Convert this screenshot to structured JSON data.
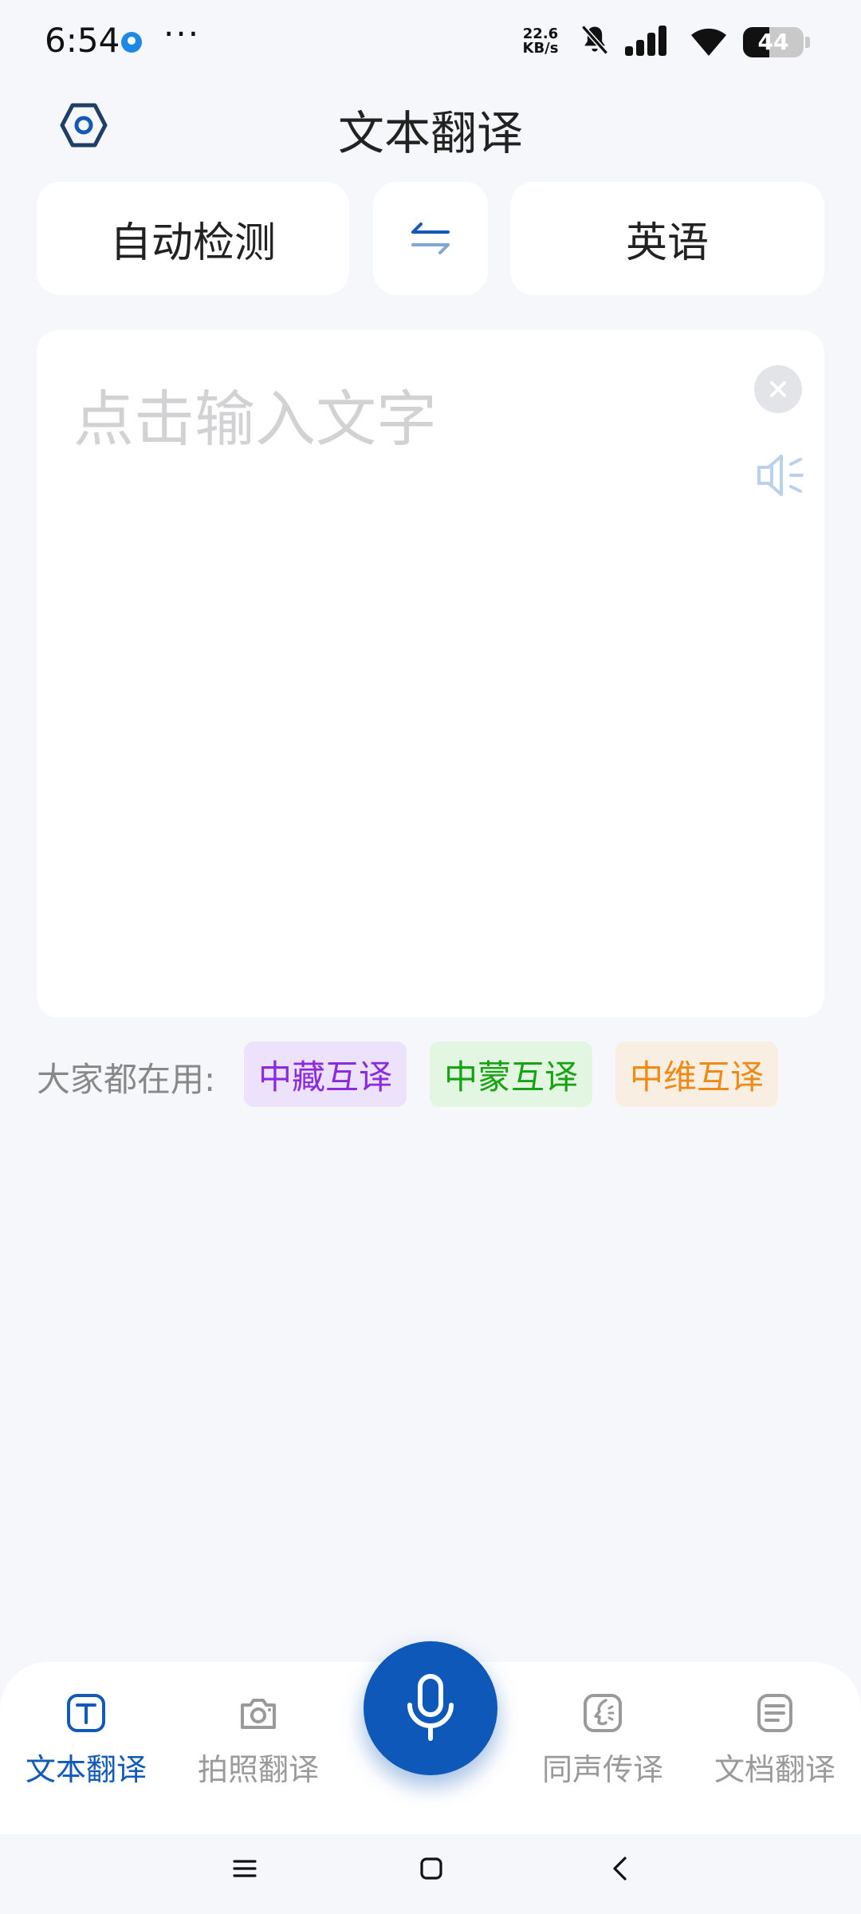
{
  "status_bar": {
    "time": "6:54",
    "more": "···",
    "net_speed_value": "22.6",
    "net_speed_unit": "KB/s",
    "battery": "44",
    "battery_level_percent": 44
  },
  "header": {
    "title": "文本翻译",
    "settings_icon": "hexagon-settings-icon"
  },
  "language_bar": {
    "source": "自动检测",
    "swap_icon": "swap-arrows-icon",
    "target": "英语"
  },
  "input": {
    "placeholder": "点击输入文字",
    "value": ""
  },
  "popular": {
    "label": "大家都在用:",
    "chips": [
      "中藏互译",
      "中蒙互译",
      "中维互译"
    ]
  },
  "bottom_nav": {
    "items": [
      {
        "label": "文本翻译",
        "active": true
      },
      {
        "label": "拍照翻译",
        "active": false
      },
      {
        "label": "同声传译",
        "active": false
      },
      {
        "label": "文档翻译",
        "active": false
      }
    ]
  },
  "colors": {
    "accent": "#1259b8",
    "mic_button": "#0e58b9",
    "chip_tibetan": "#8a2be2",
    "chip_mongolian": "#16a312",
    "chip_uyghur": "#f08a17"
  }
}
